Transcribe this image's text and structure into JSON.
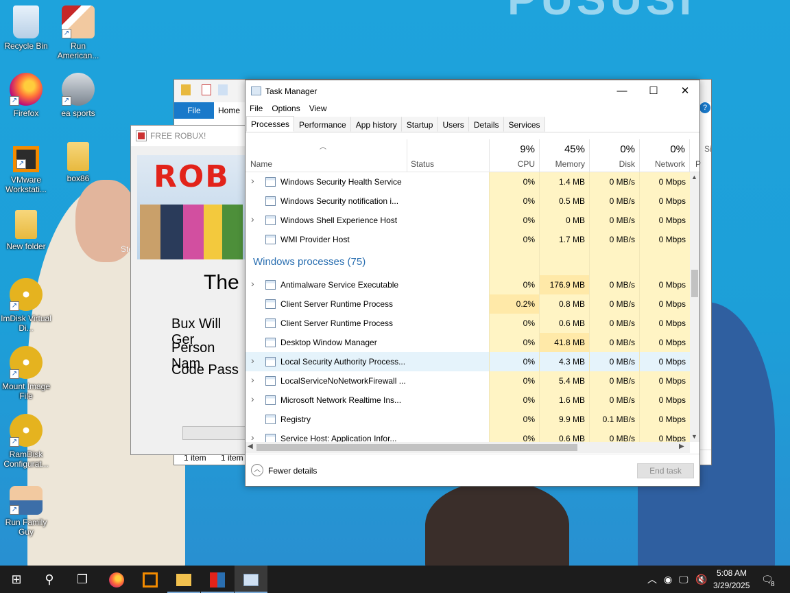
{
  "desktop": {
    "icons": [
      {
        "label": "Recycle Bin",
        "icon": "recycle-bin-icon"
      },
      {
        "label": "Run American...",
        "icon": "run-american-icon"
      },
      {
        "label": "Firefox",
        "icon": "firefox-icon"
      },
      {
        "label": "ea sports",
        "icon": "ea-sports-icon"
      },
      {
        "label": "VMware Workstati...",
        "icon": "vmware-icon"
      },
      {
        "label": "box86",
        "icon": "folder-icon"
      },
      {
        "label": "New folder",
        "icon": "folder-icon"
      },
      {
        "label": "ImDisk Virtual Di...",
        "icon": "disc-icon"
      },
      {
        "label": "Mount Image File",
        "icon": "disc-icon"
      },
      {
        "label": "RamDisk Configurat...",
        "icon": "disc-icon"
      },
      {
        "label": "Run Family Guy",
        "icon": "family-guy-icon"
      }
    ]
  },
  "explorer": {
    "file_tab": "File",
    "home_tab": "Home",
    "status_left": "1 item",
    "status_right": "1 item",
    "clipped_text": "Sto"
  },
  "robux_window": {
    "title": "FREE ROBUX!",
    "banner_text": "ROB",
    "heading": "The",
    "line1": "Bux Will Ger",
    "line2": "Person Nam",
    "line3": "Code Pass"
  },
  "task_manager": {
    "title": "Task Manager",
    "menu": [
      "File",
      "Options",
      "View"
    ],
    "tabs": [
      "Processes",
      "Performance",
      "App history",
      "Startup",
      "Users",
      "Details",
      "Services"
    ],
    "columns": {
      "name": "Name",
      "status": "Status",
      "cpu": {
        "pct": "9%",
        "label": "CPU"
      },
      "memory": {
        "pct": "45%",
        "label": "Memory"
      },
      "disk": {
        "pct": "0%",
        "label": "Disk"
      },
      "network": {
        "pct": "0%",
        "label": "Network"
      },
      "clipped": "P",
      "clipped_outer": "Si"
    },
    "rows_top": [
      {
        "name": "Windows Security Health Service",
        "cpu": "0%",
        "mem": "1.4 MB",
        "disk": "0 MB/s",
        "net": "0 Mbps",
        "expand": true
      },
      {
        "name": "Windows Security notification i...",
        "cpu": "0%",
        "mem": "0.5 MB",
        "disk": "0 MB/s",
        "net": "0 Mbps",
        "expand": false
      },
      {
        "name": "Windows Shell Experience Host",
        "cpu": "0%",
        "mem": "0 MB",
        "disk": "0 MB/s",
        "net": "0 Mbps",
        "expand": true
      },
      {
        "name": "WMI Provider Host",
        "cpu": "0%",
        "mem": "1.7 MB",
        "disk": "0 MB/s",
        "net": "0 Mbps",
        "expand": false
      }
    ],
    "group_header": "Windows processes (75)",
    "rows_bottom": [
      {
        "name": "Antimalware Service Executable",
        "cpu": "0%",
        "mem": "176.9 MB",
        "disk": "0 MB/s",
        "net": "0 Mbps",
        "expand": true
      },
      {
        "name": "Client Server Runtime Process",
        "cpu": "0.2%",
        "mem": "0.8 MB",
        "disk": "0 MB/s",
        "net": "0 Mbps",
        "expand": false
      },
      {
        "name": "Client Server Runtime Process",
        "cpu": "0%",
        "mem": "0.6 MB",
        "disk": "0 MB/s",
        "net": "0 Mbps",
        "expand": false
      },
      {
        "name": "Desktop Window Manager",
        "cpu": "0%",
        "mem": "41.8 MB",
        "disk": "0 MB/s",
        "net": "0 Mbps",
        "expand": false
      },
      {
        "name": "Local Security Authority Process...",
        "cpu": "0%",
        "mem": "4.3 MB",
        "disk": "0 MB/s",
        "net": "0 Mbps",
        "expand": true
      },
      {
        "name": "LocalServiceNoNetworkFirewall ...",
        "cpu": "0%",
        "mem": "5.4 MB",
        "disk": "0 MB/s",
        "net": "0 Mbps",
        "expand": true
      },
      {
        "name": "Microsoft Network Realtime Ins...",
        "cpu": "0%",
        "mem": "1.6 MB",
        "disk": "0 MB/s",
        "net": "0 Mbps",
        "expand": true
      },
      {
        "name": "Registry",
        "cpu": "0%",
        "mem": "9.9 MB",
        "disk": "0.1 MB/s",
        "net": "0 Mbps",
        "expand": false
      },
      {
        "name": "Service Host: Application Infor...",
        "cpu": "0%",
        "mem": "0.6 MB",
        "disk": "0 MB/s",
        "net": "0 Mbps",
        "expand": true
      }
    ],
    "fewer_details": "Fewer details",
    "end_task": "End task"
  },
  "taskbar": {
    "time": "5:08 AM",
    "date": "3/29/2025",
    "notification_count": "8"
  },
  "colors": {
    "heat_cell": "#fff4c4",
    "heat_cell_warm": "#ffe9a8",
    "group_header": "#2a6fb1",
    "selected_row": "#e5f3fb",
    "taskbar": "#1c1c1c",
    "desktop": "#1ea3dc"
  }
}
